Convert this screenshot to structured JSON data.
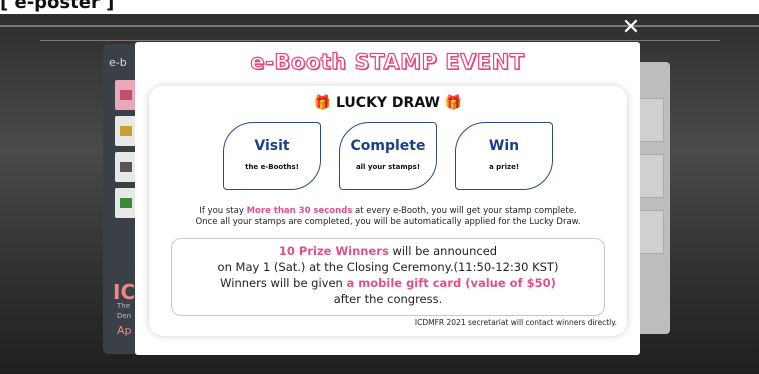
{
  "page_header": {
    "text": "[ e-poster ]"
  },
  "left_panel": {
    "label": "e-b",
    "logo": "IC",
    "line1": "The",
    "line2": "Den",
    "line3": "Ap"
  },
  "modal": {
    "title": "e-Booth STAMP EVENT",
    "close_icon": "close-icon",
    "lucky_draw": {
      "gift_icon": "🎁",
      "text": "LUCKY DRAW"
    },
    "steps": [
      {
        "title": "Visit",
        "subtitle": "the e-Booths!"
      },
      {
        "title": "Complete",
        "subtitle": "all your stamps!"
      },
      {
        "title": "Win",
        "subtitle": "a prize!"
      }
    ],
    "description": {
      "line1_pre": "If you stay ",
      "line1_hl": "More than 30 seconds",
      "line1_post": " at every e-Booth, you will get your stamp complete.",
      "line2": "Once all your stamps are completed, you will be automatically applied for the Lucky Draw."
    },
    "prize": {
      "line1_hl": "10 Prize Winners",
      "line1_post": " will be announced",
      "line2": "on May 1 (Sat.) at the Closing Ceremony.(11:50-12:30 KST)",
      "line3_pre": "Winners will be given ",
      "line3_hl": "a mobile gift card (value of $50)",
      "line4": "after the congress."
    },
    "contact": "ICDMFR 2021 secretariat will contact winners directly."
  },
  "colors": {
    "accent_pink": "#e0508a",
    "step_blue": "#1b3f8c"
  }
}
